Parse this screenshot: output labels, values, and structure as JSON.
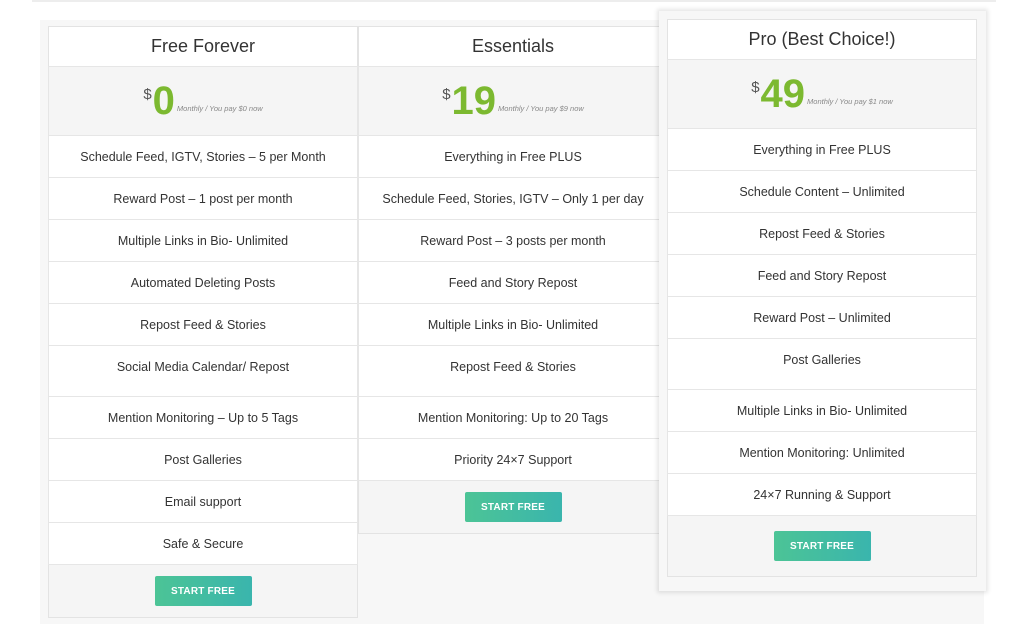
{
  "plans": [
    {
      "title": "Free Forever",
      "currency": "$",
      "price": "0",
      "period": "Monthly / You pay $0 now",
      "features_top": [
        "Schedule Feed, IGTV, Stories – 5 per Month",
        "Reward Post – 1 post per month",
        "Multiple Links in Bio- Unlimited",
        "Automated Deleting Posts",
        "Repost Feed & Stories",
        "Social Media Calendar/ Repost"
      ],
      "features_bottom": [
        "Mention Monitoring – Up to 5 Tags",
        "Post Galleries",
        "Email support",
        "Safe & Secure"
      ],
      "button": "START FREE"
    },
    {
      "title": "Essentials",
      "currency": "$",
      "price": "19",
      "period": "Monthly / You pay $9 now",
      "features_top": [
        "Everything in Free PLUS",
        "Schedule Feed, Stories, IGTV – Only 1 per day",
        "Reward Post – 3 posts per month",
        "Feed and Story Repost",
        "Multiple Links in Bio- Unlimited",
        "Repost Feed & Stories"
      ],
      "features_bottom": [
        "Mention Monitoring: Up to 20 Tags",
        "Priority 24×7 Support"
      ],
      "button": "START FREE"
    },
    {
      "title": "Pro (Best Choice!)",
      "currency": "$",
      "price": "49",
      "period": "Monthly / You pay $1 now",
      "features_top": [
        "Everything in Free PLUS",
        "Schedule Content – Unlimited",
        "Repost Feed & Stories",
        "Feed and Story Repost",
        "Reward Post – Unlimited",
        "Post Galleries"
      ],
      "features_bottom": [
        "Multiple Links in Bio- Unlimited",
        "Mention Monitoring: Unlimited",
        "24×7 Running & Support"
      ],
      "button": "START FREE"
    }
  ],
  "colors": {
    "price": "#7cb930",
    "button_start": "#4cc496",
    "button_end": "#3ab5ad",
    "price_bg": "#f5f5f5"
  }
}
